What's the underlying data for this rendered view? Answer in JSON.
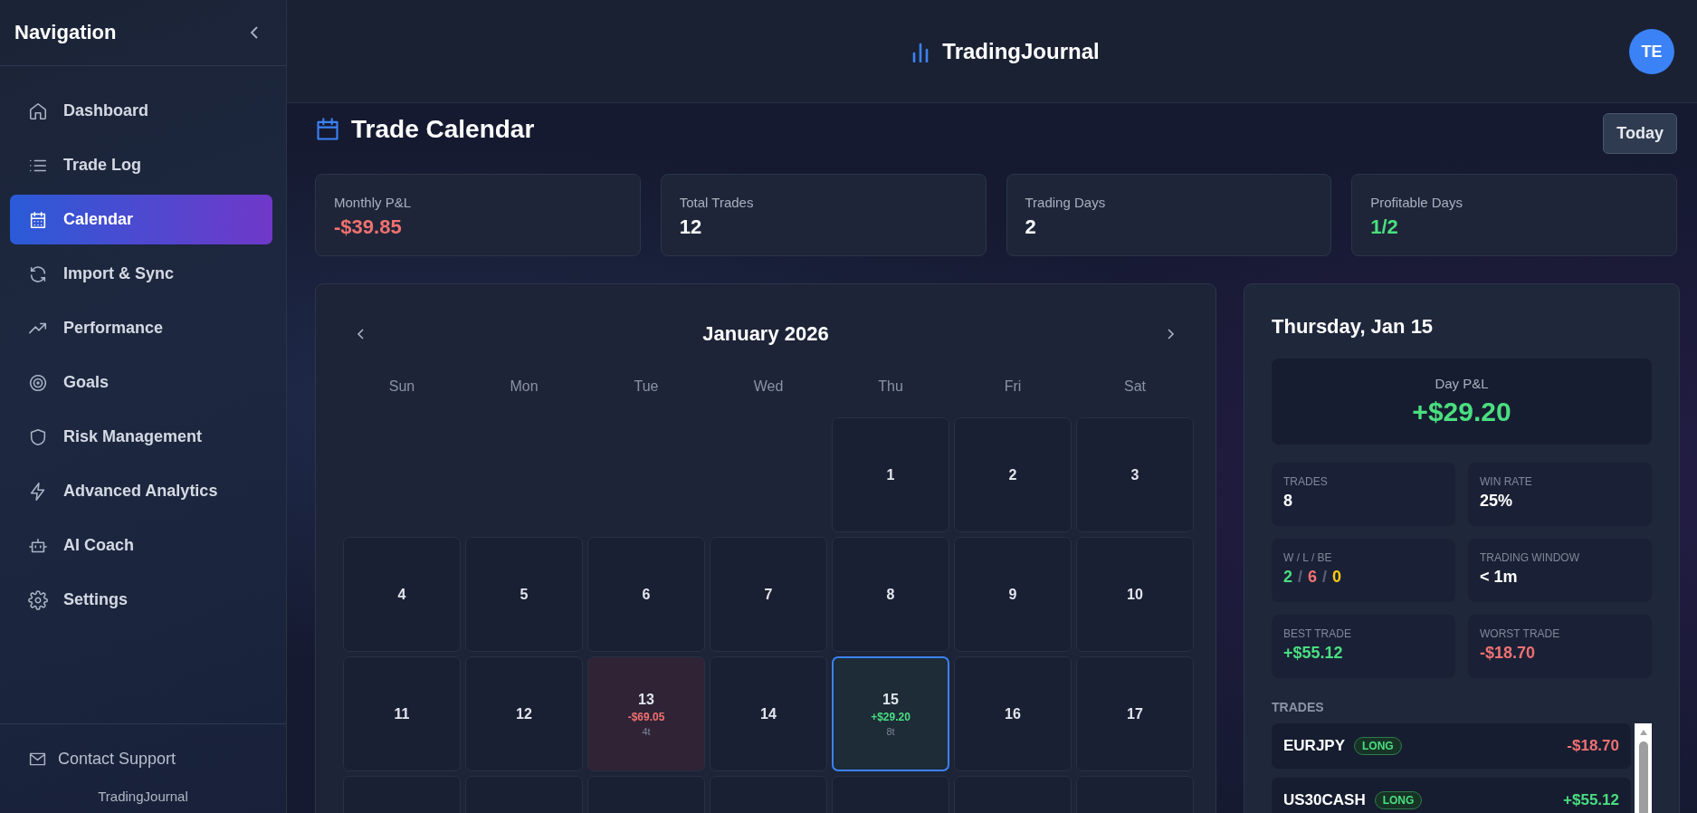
{
  "sidebar": {
    "title": "Navigation",
    "items": [
      {
        "label": "Dashboard",
        "selected": false
      },
      {
        "label": "Trade Log",
        "selected": false
      },
      {
        "label": "Calendar",
        "selected": true
      },
      {
        "label": "Import & Sync",
        "selected": false
      },
      {
        "label": "Performance",
        "selected": false
      },
      {
        "label": "Goals",
        "selected": false
      },
      {
        "label": "Risk Management",
        "selected": false
      },
      {
        "label": "Advanced Analytics",
        "selected": false
      },
      {
        "label": "AI Coach",
        "selected": false
      },
      {
        "label": "Settings",
        "selected": false
      }
    ],
    "support": "Contact Support",
    "footer": "TradingJournal"
  },
  "header": {
    "brand": "TradingJournal",
    "avatar": "TE"
  },
  "page": {
    "title": "Trade Calendar",
    "today_button": "Today"
  },
  "stats": [
    {
      "label": "Monthly P&L",
      "value": "-$39.85",
      "color": "#f07171"
    },
    {
      "label": "Total Trades",
      "value": "12",
      "color": "#ffffff"
    },
    {
      "label": "Trading Days",
      "value": "2",
      "color": "#ffffff"
    },
    {
      "label": "Profitable Days",
      "value": "1/2",
      "color": "#4ade80"
    }
  ],
  "calendar": {
    "month": "January 2026",
    "weekdays": [
      "Sun",
      "Mon",
      "Tue",
      "Wed",
      "Thu",
      "Fri",
      "Sat"
    ],
    "weeks": [
      [
        {
          "kind": "empty"
        },
        {
          "kind": "empty"
        },
        {
          "kind": "empty"
        },
        {
          "kind": "empty"
        },
        {
          "kind": "day",
          "day": "1",
          "selected": false
        },
        {
          "kind": "day",
          "day": "2",
          "selected": false
        },
        {
          "kind": "day",
          "day": "3",
          "selected": false
        }
      ],
      [
        {
          "kind": "day",
          "day": "4",
          "selected": false
        },
        {
          "kind": "day",
          "day": "5",
          "selected": false
        },
        {
          "kind": "day",
          "day": "6",
          "selected": false
        },
        {
          "kind": "day",
          "day": "7",
          "selected": false
        },
        {
          "kind": "day",
          "day": "8",
          "selected": false
        },
        {
          "kind": "day",
          "day": "9",
          "selected": false
        },
        {
          "kind": "day",
          "day": "10",
          "selected": false
        }
      ],
      [
        {
          "kind": "day",
          "day": "11",
          "selected": false
        },
        {
          "kind": "day",
          "day": "12",
          "selected": false
        },
        {
          "kind": "loss",
          "day": "13",
          "selected": false,
          "pnl": "-$69.05",
          "count": "4t"
        },
        {
          "kind": "day",
          "day": "14",
          "selected": false
        },
        {
          "kind": "win",
          "day": "15",
          "selected": true,
          "pnl": "+$29.20",
          "count": "8t"
        },
        {
          "kind": "day",
          "day": "16",
          "selected": false
        },
        {
          "kind": "day",
          "day": "17",
          "selected": false
        }
      ],
      [
        {
          "kind": "day",
          "selected": false
        },
        {
          "kind": "day",
          "selected": false
        },
        {
          "kind": "day",
          "selected": false
        },
        {
          "kind": "day",
          "selected": false
        },
        {
          "kind": "day",
          "selected": false
        },
        {
          "kind": "day",
          "selected": false
        },
        {
          "kind": "day",
          "selected": false
        }
      ]
    ]
  },
  "day_panel": {
    "title": "Thursday, Jan 15",
    "day_pnl_label": "Day P&L",
    "day_pnl": {
      "value": "+$29.20",
      "color": "#4ade80"
    },
    "metrics": [
      {
        "label": "TRADES",
        "kind": "plain",
        "value": "8",
        "color": "#ffffff"
      },
      {
        "label": "WIN RATE",
        "kind": "plain",
        "value": "25%",
        "color": "#ffffff"
      },
      {
        "label": "W / L / BE",
        "kind": "split",
        "separator": "/",
        "parts": [
          {
            "text": "2",
            "color": "#4ade80"
          },
          {
            "text": "6",
            "color": "#f07171"
          },
          {
            "text": "0",
            "color": "#facc15"
          }
        ]
      },
      {
        "label": "TRADING WINDOW",
        "kind": "plain",
        "value": "< 1m",
        "color": "#ffffff"
      },
      {
        "label": "BEST TRADE",
        "kind": "plain",
        "value": "+$55.12",
        "color": "#4ade80"
      },
      {
        "label": "WORST TRADE",
        "kind": "plain",
        "value": "-$18.70",
        "color": "#f07171"
      }
    ],
    "trades_heading": "TRADES",
    "trades": [
      {
        "symbol": "EURJPY",
        "side": "LONG",
        "pnl": "-$18.70",
        "color": "#f07171"
      },
      {
        "symbol": "US30CASH",
        "side": "LONG",
        "pnl": "+$55.12",
        "color": "#4ade80"
      }
    ]
  }
}
